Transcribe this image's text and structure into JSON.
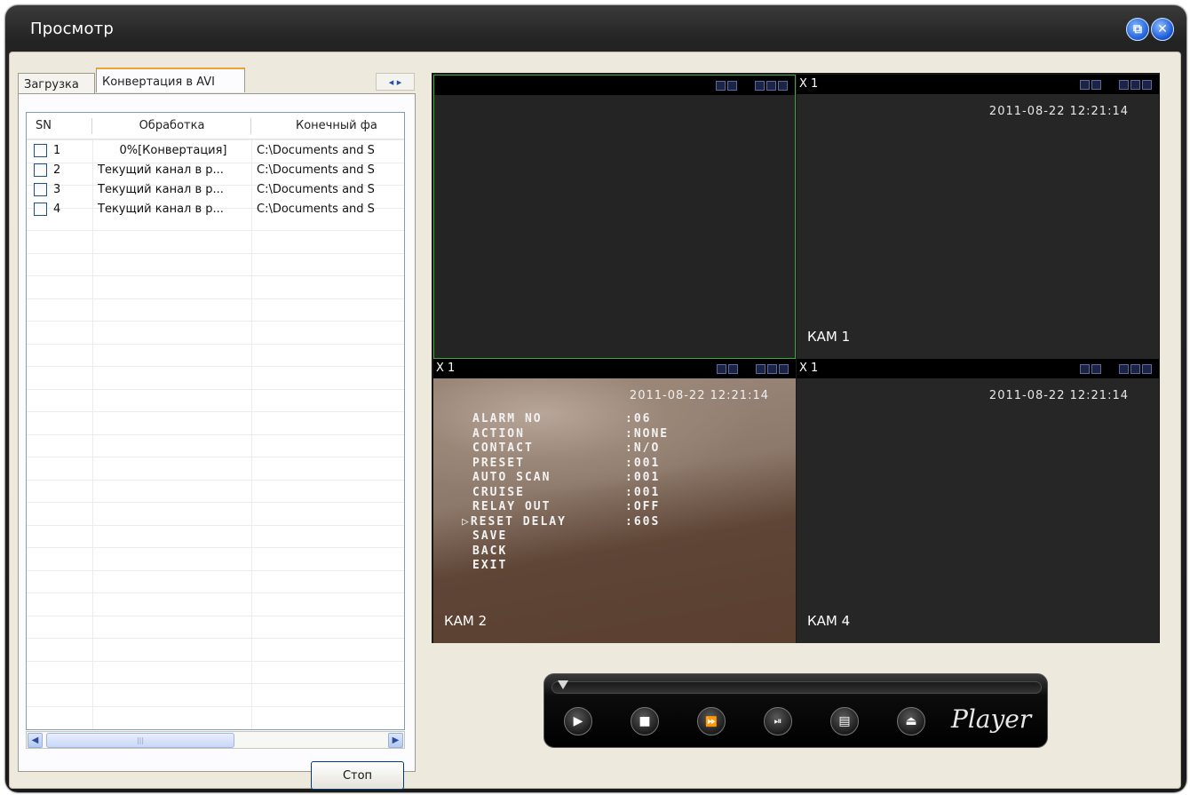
{
  "window": {
    "title": "Просмотр",
    "buttons": [
      "restore-icon",
      "close-icon"
    ]
  },
  "left_panel": {
    "tabs": [
      {
        "label": "Загрузка",
        "active": false
      },
      {
        "label": "Конвертация в AVI",
        "active": true
      }
    ],
    "tab_scroll_arrows": "◂ ▸",
    "table": {
      "columns": [
        "SN",
        "Обработка",
        "Конечный фа"
      ],
      "rows": [
        {
          "sn": "1",
          "processing": "0%[Конвертация]",
          "destination": "C:\\Documents and S",
          "checked": false
        },
        {
          "sn": "2",
          "processing": "Текущий канал в р...",
          "destination": "C:\\Documents and S",
          "checked": false
        },
        {
          "sn": "3",
          "processing": "Текущий канал в р...",
          "destination": "C:\\Documents and S",
          "checked": false
        },
        {
          "sn": "4",
          "processing": "Текущий канал в р...",
          "destination": "C:\\Documents and S",
          "checked": false
        }
      ]
    },
    "scrollbar": {
      "left": "◀",
      "right": "▶",
      "thumb_grip": "|||"
    },
    "stop_button": "Стоп"
  },
  "video": {
    "cells": [
      {
        "speed": "",
        "timestamp": "",
        "camera": "",
        "selected": true
      },
      {
        "speed": "X 1",
        "timestamp": "2011-08-22 12:21:14",
        "camera": "КАМ 1"
      },
      {
        "speed": "X 1",
        "timestamp": "2011-08-22 12:21:14",
        "camera": "КАМ 2"
      },
      {
        "speed": "X 1",
        "timestamp": "2011-08-22 12:21:14",
        "camera": "КАМ 4"
      }
    ],
    "osd_menu": [
      {
        "key": "ALARM NO",
        "value": ":06"
      },
      {
        "key": "ACTION",
        "value": ":NONE"
      },
      {
        "key": "CONTACT",
        "value": ":N/O"
      },
      {
        "key": "PRESET",
        "value": ":001"
      },
      {
        "key": "AUTO SCAN",
        "value": ":001"
      },
      {
        "key": "CRUISE",
        "value": ":001"
      },
      {
        "key": "RELAY OUT",
        "value": ":OFF"
      },
      {
        "key": "▷RESET DELAY",
        "value": ":60S"
      },
      {
        "key": "SAVE",
        "value": ""
      },
      {
        "key": "BACK",
        "value": ""
      },
      {
        "key": "EXIT",
        "value": ""
      }
    ]
  },
  "player": {
    "logo": "Player",
    "buttons": [
      "play-icon",
      "stop-icon",
      "fast-forward-icon",
      "step-forward-icon",
      "playlist-icon",
      "eject-icon"
    ],
    "glyphs": {
      "play": "▶",
      "stop": "■",
      "ff": "⏩",
      "step": "⏯",
      "list": "▤",
      "eject": "⏏"
    }
  }
}
